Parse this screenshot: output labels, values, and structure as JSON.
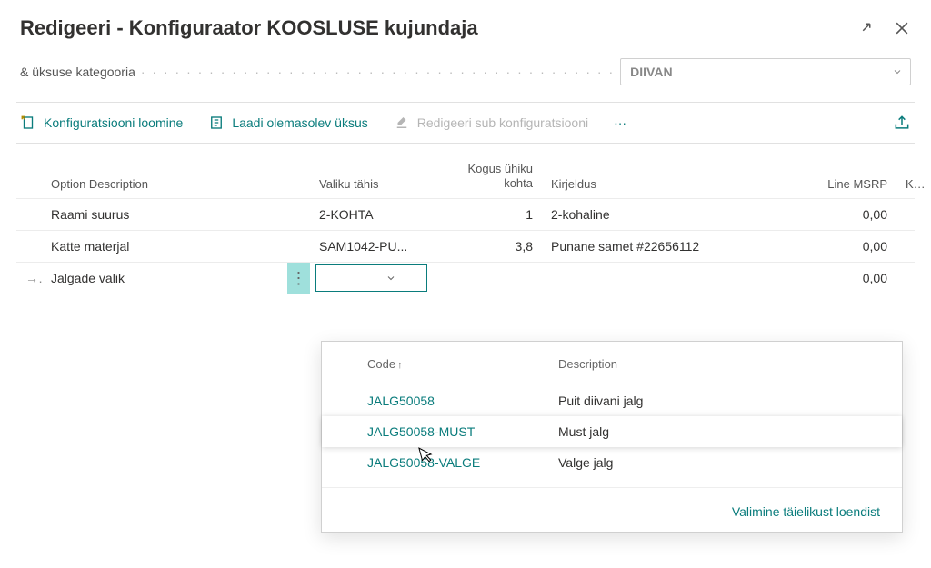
{
  "header": {
    "title": "Redigeeri - Konfiguraator KOOSLUSE kujundaja"
  },
  "category": {
    "label": "& üksuse kategooria",
    "value": "DIIVAN"
  },
  "toolbar": {
    "create": "Konfiguratsiooni loomine",
    "load": "Laadi olemasolev üksus",
    "edit_sub": "Redigeeri sub konfiguratsiooni",
    "more": "···"
  },
  "columns": {
    "option_desc": "Option Description",
    "valiku_tahis": "Valiku tähis",
    "qty_line1": "Kogus ühiku",
    "qty_line2": "kohta",
    "kirjeldus": "Kirjeldus",
    "line_msrp": "Line MSRP",
    "kauba": "Kauba"
  },
  "rows": [
    {
      "option": "Raami suurus",
      "tahis": "2-KOHTA",
      "qty": "1",
      "desc": "2-kohaline",
      "msrp": "0,00"
    },
    {
      "option": "Katte materjal",
      "tahis": "SAM1042-PU...",
      "qty": "3,8",
      "desc": "Punane samet #22656112",
      "msrp": "0,00"
    },
    {
      "option": "Jalgade valik",
      "tahis": "",
      "qty": "",
      "desc": "",
      "msrp": "0,00"
    }
  ],
  "dropdown": {
    "col_code": "Code",
    "col_desc": "Description",
    "items": [
      {
        "code": "JALG50058",
        "desc": "Puit diivani jalg"
      },
      {
        "code": "JALG50058-MUST",
        "desc": "Must jalg"
      },
      {
        "code": "JALG50058-VALGE",
        "desc": "Valge jalg"
      }
    ],
    "footer": "Valimine täielikust loendist"
  }
}
